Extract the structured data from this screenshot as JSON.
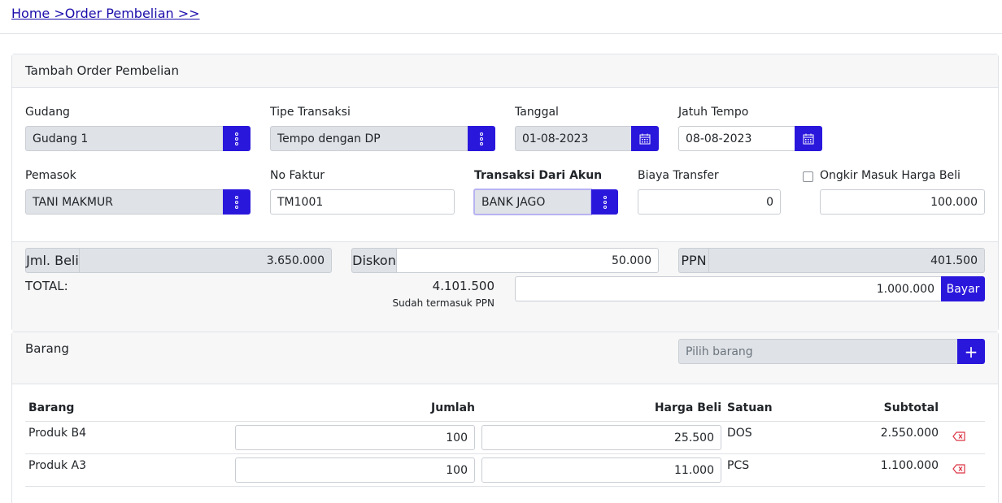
{
  "breadcrumb": "Home >Order Pembelian >>",
  "form": {
    "title": "Tambah Order Pembelian",
    "gudang": {
      "label": "Gudang",
      "value": "Gudang 1"
    },
    "tipe_transaksi": {
      "label": "Tipe Transaksi",
      "value": "Tempo dengan DP"
    },
    "tanggal": {
      "label": "Tanggal",
      "value": "01-08-2023"
    },
    "jatuh_tempo": {
      "label": "Jatuh Tempo",
      "value": "08-08-2023"
    },
    "pemasok": {
      "label": "Pemasok",
      "value": "TANI MAKMUR"
    },
    "no_faktur": {
      "label": "No Faktur",
      "value": "TM1001"
    },
    "transaksi_akun": {
      "label": "Transaksi Dari Akun",
      "value": "BANK JAGO"
    },
    "biaya_transfer": {
      "label": "Biaya Transfer",
      "value": "0"
    },
    "ongkir": {
      "label": "Ongkir Masuk Harga Beli",
      "value": "100.000",
      "checked": false
    }
  },
  "summary": {
    "jml_beli": {
      "label": "Jml. Beli",
      "value": "3.650.000"
    },
    "diskon": {
      "label": "Diskon",
      "value": "50.000"
    },
    "ppn": {
      "label": "PPN",
      "value": "401.500"
    },
    "total_label": "TOTAL:",
    "total_value": "4.101.500",
    "total_note": "Sudah termasuk PPN",
    "bayar_value": "1.000.000",
    "bayar_label": "Bayar"
  },
  "barang": {
    "title": "Barang",
    "search_placeholder": "Pilih barang",
    "add_label": "+",
    "headers": {
      "barang": "Barang",
      "jumlah": "Jumlah",
      "harga": "Harga Beli",
      "satuan": "Satuan",
      "subtotal": "Subtotal"
    },
    "rows": [
      {
        "name": "Produk B4",
        "jumlah": "100",
        "harga": "25.500",
        "satuan": "DOS",
        "subtotal": "2.550.000"
      },
      {
        "name": "Produk A3",
        "jumlah": "100",
        "harga": "11.000",
        "satuan": "PCS",
        "subtotal": "1.100.000"
      }
    ]
  },
  "colors": {
    "primary": "#2a17dc",
    "danger": "#dc3545"
  }
}
